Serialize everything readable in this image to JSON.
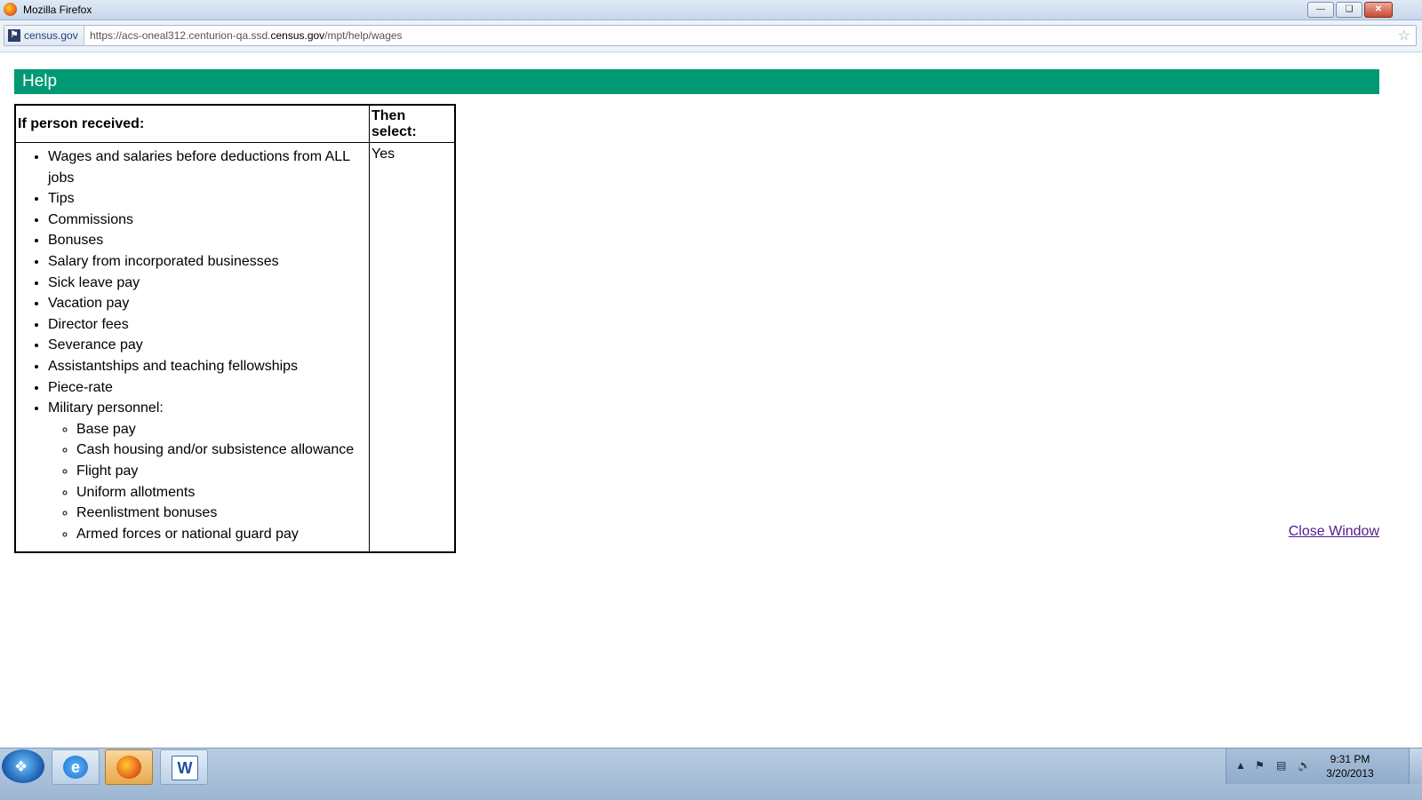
{
  "window": {
    "title": "Mozilla Firefox",
    "minimize_icon": "minimize-icon",
    "restore_icon": "restore-icon",
    "close_icon": "close-icon"
  },
  "addressbar": {
    "site_identity": "census.gov",
    "url_prefix": "https://acs-oneal312.centurion-qa.ssd.",
    "url_domain": "census.gov",
    "url_suffix": "/mpt/help/wages"
  },
  "page": {
    "header": "Help",
    "accent_color": "#009973",
    "table": {
      "col1_header": "If person received:",
      "col2_header": "Then select:",
      "items": [
        "Wages and salaries before deductions from ALL jobs",
        "Tips",
        "Commissions",
        "Bonuses",
        "Salary from incorporated businesses",
        "Sick leave pay",
        "Vacation pay",
        "Director fees",
        "Severance pay",
        "Assistantships and teaching fellowships",
        "Piece-rate",
        "Military personnel:"
      ],
      "military_items": [
        "Base pay",
        "Cash housing and/or subsistence allowance",
        "Flight pay",
        "Uniform allotments",
        "Reenlistment bonuses",
        "Armed forces or national guard pay"
      ],
      "selection": "Yes"
    },
    "close_link": "Close Window"
  },
  "taskbar": {
    "apps": [
      "internet-explorer-icon",
      "firefox-icon",
      "word-icon"
    ],
    "clock_time": "9:31 PM",
    "clock_date": "3/20/2013"
  }
}
